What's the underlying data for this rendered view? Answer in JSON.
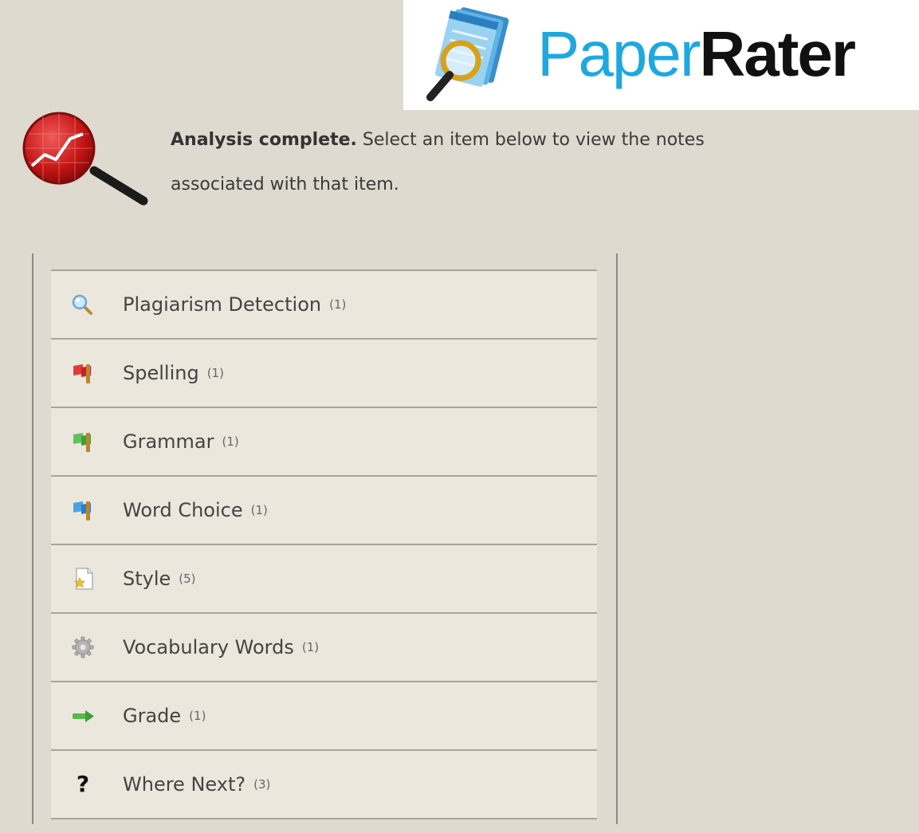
{
  "logo": {
    "text_light": "Paper",
    "text_bold": "Rater",
    "accent_color": "#1ea8e0",
    "icon": "magnifier-over-paper-icon"
  },
  "status": {
    "icon": "red-chart-magnifier-icon",
    "heading": "Analysis complete.",
    "text": " Select an item below to view the notes associated with that item."
  },
  "menu": {
    "items": [
      {
        "label": "Plagiarism Detection",
        "count": "(1)",
        "icon": "magnifier-icon"
      },
      {
        "label": "Spelling",
        "count": "(1)",
        "icon": "red-flag-icon"
      },
      {
        "label": "Grammar",
        "count": "(1)",
        "icon": "green-flag-icon"
      },
      {
        "label": "Word Choice",
        "count": "(1)",
        "icon": "blue-flag-icon"
      },
      {
        "label": "Style",
        "count": "(5)",
        "icon": "star-page-icon"
      },
      {
        "label": "Vocabulary Words",
        "count": "(1)",
        "icon": "gear-icon"
      },
      {
        "label": "Grade",
        "count": "(1)",
        "icon": "green-arrow-icon"
      },
      {
        "label": "Where Next?",
        "count": "(3)",
        "icon": "question-icon",
        "glyph": "?"
      }
    ]
  }
}
